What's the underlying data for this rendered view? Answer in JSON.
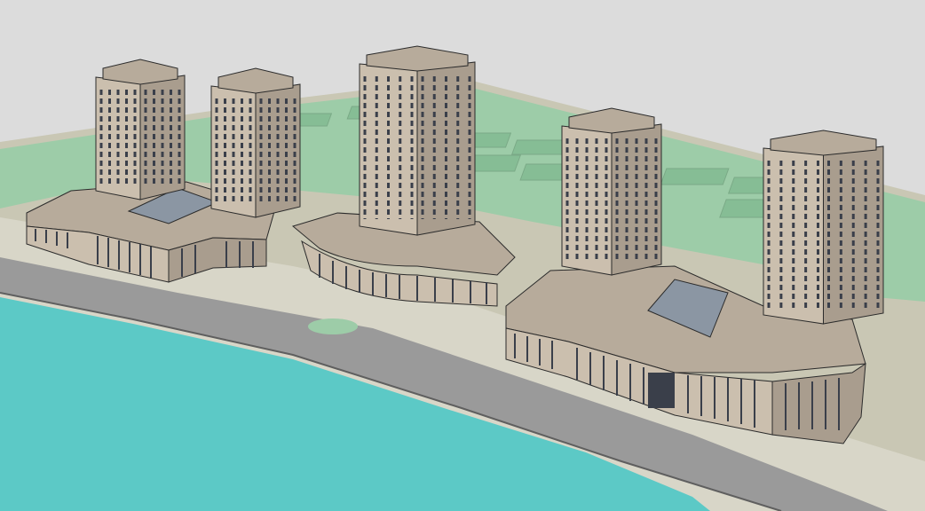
{
  "scene": {
    "colors": {
      "sky": "#dcdcdc",
      "ground": "#c9c7b4",
      "lawn": "#9dcca8",
      "lawn_dark": "#86bd95",
      "road": "#9a9a9a",
      "road_dark": "#6f6f6f",
      "promenade": "#d8d6c8",
      "water": "#5cc9c6",
      "facade": "#cbbfae",
      "facade_shade": "#a99d8e",
      "roof": "#b7ab9b",
      "window": "#3a3f4a",
      "glass": "#8b96a3",
      "outline": "#2b2b2b"
    },
    "towers": [
      {
        "name": "tower-1"
      },
      {
        "name": "tower-2"
      },
      {
        "name": "tower-3"
      },
      {
        "name": "tower-4"
      },
      {
        "name": "tower-5"
      }
    ],
    "podiums": [
      {
        "name": "podium-west"
      },
      {
        "name": "podium-center-curved"
      },
      {
        "name": "podium-east"
      }
    ],
    "skylights": [
      {
        "name": "skylight-west"
      },
      {
        "name": "skylight-east"
      }
    ]
  }
}
